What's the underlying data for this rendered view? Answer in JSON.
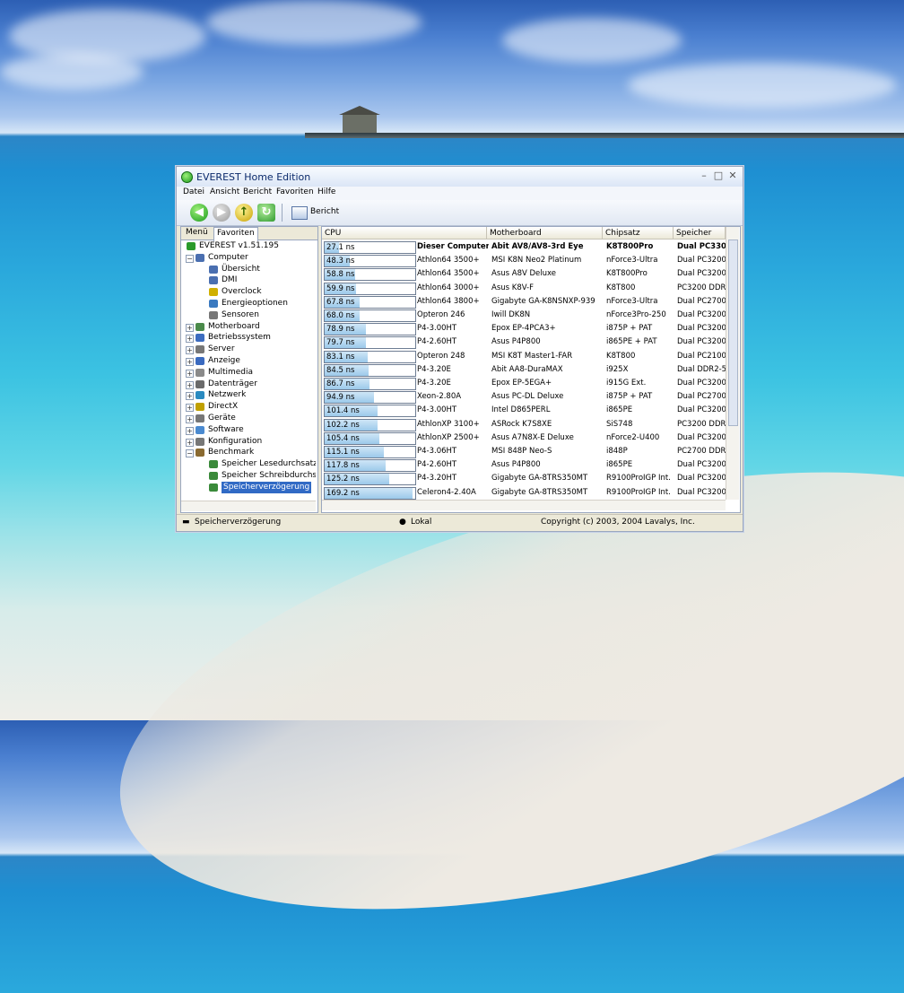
{
  "window": {
    "title": "EVEREST Home Edition"
  },
  "menu": [
    "Datei",
    "Ansicht",
    "Bericht",
    "Favoriten",
    "Hilfe"
  ],
  "toolbar": {
    "report_label": "Bericht"
  },
  "left_tabs": [
    "Menü",
    "Favoriten"
  ],
  "tree": [
    {
      "label": "EVEREST v1.51.195",
      "icon": "info-icon"
    },
    {
      "label": "Computer",
      "icon": "computer-icon"
    },
    {
      "label": "Übersicht",
      "icon": "computer-icon"
    },
    {
      "label": "DMI",
      "icon": "computer-icon"
    },
    {
      "label": "Overclock",
      "icon": "xp-logo-icon"
    },
    {
      "label": "Energieoptionen",
      "icon": "power-icon"
    },
    {
      "label": "Sensoren",
      "icon": "sensor-icon"
    },
    {
      "label": "Motherboard",
      "icon": "motherboard-icon"
    },
    {
      "label": "Betriebssystem",
      "icon": "windows-icon"
    },
    {
      "label": "Server",
      "icon": "server-icon"
    },
    {
      "label": "Anzeige",
      "icon": "display-icon"
    },
    {
      "label": "Multimedia",
      "icon": "multimedia-icon"
    },
    {
      "label": "Datenträger",
      "icon": "drive-icon"
    },
    {
      "label": "Netzwerk",
      "icon": "network-icon"
    },
    {
      "label": "DirectX",
      "icon": "directx-icon"
    },
    {
      "label": "Geräte",
      "icon": "devices-icon"
    },
    {
      "label": "Software",
      "icon": "software-icon"
    },
    {
      "label": "Konfiguration",
      "icon": "config-icon"
    },
    {
      "label": "Benchmark",
      "icon": "hourglass-icon"
    },
    {
      "label": "Speicher Lesedurchsatz",
      "icon": "ram-icon"
    },
    {
      "label": "Speicher Schreibdurchsat",
      "icon": "ram-icon"
    },
    {
      "label": "Speicherverzögerung",
      "icon": "ram-icon"
    }
  ],
  "columns": [
    "CPU",
    "Motherboard",
    "Chipsatz",
    "Speicher"
  ],
  "rows": [
    {
      "value": "27.1 ns",
      "ns": 27.1,
      "cpu": "Dieser Computer",
      "board": "Abit AV8/AV8-3rd Eye",
      "chipset": "K8T800Pro",
      "memory": "Dual PC3300",
      "bold": true
    },
    {
      "value": "48.3 ns",
      "ns": 48.3,
      "cpu": "Athlon64 3500+",
      "board": "MSI K8N Neo2 Platinum",
      "chipset": "nForce3-Ultra",
      "memory": "Dual PC3200 D"
    },
    {
      "value": "58.8 ns",
      "ns": 58.8,
      "cpu": "Athlon64 3500+",
      "board": "Asus A8V Deluxe",
      "chipset": "K8T800Pro",
      "memory": "Dual PC3200 D"
    },
    {
      "value": "59.9 ns",
      "ns": 59.9,
      "cpu": "Athlon64 3000+",
      "board": "Asus K8V-F",
      "chipset": "K8T800",
      "memory": "PC3200 DDR S"
    },
    {
      "value": "67.8 ns",
      "ns": 67.8,
      "cpu": "Athlon64 3800+",
      "board": "Gigabyte GA-K8NSNXP-939",
      "chipset": "nForce3-Ultra",
      "memory": "Dual PC2700 D"
    },
    {
      "value": "68.0 ns",
      "ns": 68.0,
      "cpu": "Opteron 246",
      "board": "Iwill DK8N",
      "chipset": "nForce3Pro-250",
      "memory": "Dual PC3200R"
    },
    {
      "value": "78.9 ns",
      "ns": 78.9,
      "cpu": "P4-3.00HT",
      "board": "Epox EP-4PCA3+",
      "chipset": "i875P + PAT",
      "memory": "Dual PC3200 D"
    },
    {
      "value": "79.7 ns",
      "ns": 79.7,
      "cpu": "P4-2.60HT",
      "board": "Asus P4P800",
      "chipset": "i865PE + PAT",
      "memory": "Dual PC3200 D"
    },
    {
      "value": "83.1 ns",
      "ns": 83.1,
      "cpu": "Opteron 248",
      "board": "MSI K8T Master1-FAR",
      "chipset": "K8T800",
      "memory": "Dual PC2100R"
    },
    {
      "value": "84.5 ns",
      "ns": 84.5,
      "cpu": "P4-3.20E",
      "board": "Abit AA8-DuraMAX",
      "chipset": "i925X",
      "memory": "Dual DDR2-53"
    },
    {
      "value": "86.7 ns",
      "ns": 86.7,
      "cpu": "P4-3.20E",
      "board": "Epox EP-5EGA+",
      "chipset": "i915G Ext.",
      "memory": "Dual PC3200 D"
    },
    {
      "value": "94.9 ns",
      "ns": 94.9,
      "cpu": "Xeon-2.80A",
      "board": "Asus PC-DL Deluxe",
      "chipset": "i875P + PAT",
      "memory": "Dual PC2700 D"
    },
    {
      "value": "101.4 ns",
      "ns": 101.4,
      "cpu": "P4-3.00HT",
      "board": "Intel D865PERL",
      "chipset": "i865PE",
      "memory": "Dual PC3200 D"
    },
    {
      "value": "102.2 ns",
      "ns": 102.2,
      "cpu": "AthlonXP 3100+",
      "board": "ASRock K7S8XE",
      "chipset": "SiS748",
      "memory": "PC3200 DDR S"
    },
    {
      "value": "105.4 ns",
      "ns": 105.4,
      "cpu": "AthlonXP 2500+",
      "board": "Asus A7N8X-E Deluxe",
      "chipset": "nForce2-U400",
      "memory": "Dual PC3200 D"
    },
    {
      "value": "115.1 ns",
      "ns": 115.1,
      "cpu": "P4-3.06HT",
      "board": "MSI 848P Neo-S",
      "chipset": "i848P",
      "memory": "PC2700 DDR S"
    },
    {
      "value": "117.8 ns",
      "ns": 117.8,
      "cpu": "P4-2.60HT",
      "board": "Asus P4P800",
      "chipset": "i865PE",
      "memory": "Dual PC3200 D"
    },
    {
      "value": "125.2 ns",
      "ns": 125.2,
      "cpu": "P4-3.20HT",
      "board": "Gigabyte GA-8TRS350MT",
      "chipset": "R9100ProIGP Int.",
      "memory": "Dual PC3200 D"
    },
    {
      "value": "169.2 ns",
      "ns": 169.2,
      "cpu": "Celeron4-2.40A",
      "board": "Gigabyte GA-8TRS350MT",
      "chipset": "R9100ProIGP Int.",
      "memory": "Dual PC3200 D"
    }
  ],
  "status": {
    "left": "Speicherverzögerung",
    "middle": "Lokal",
    "right": "Copyright (c) 2003, 2004 Lavalys, Inc."
  }
}
